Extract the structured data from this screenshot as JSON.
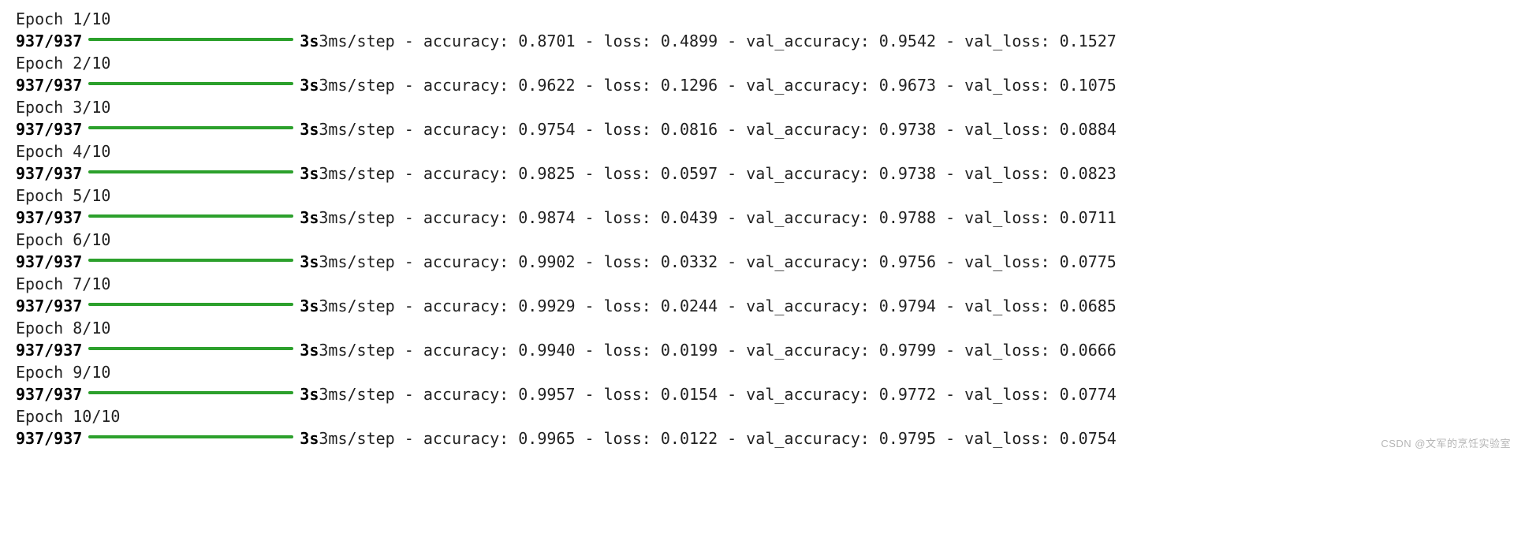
{
  "total_epochs": 10,
  "steps_current": "937",
  "steps_total": "937",
  "watermark": "CSDN @文军的烹饪实验室",
  "epochs": [
    {
      "header": "Epoch 1/10",
      "step_label": "937/937",
      "total_time": "3s",
      "time_per_step": "3ms/step",
      "accuracy": "0.8701",
      "loss": "0.4899",
      "val_accuracy": "0.9542",
      "val_loss": "0.1527"
    },
    {
      "header": "Epoch 2/10",
      "step_label": "937/937",
      "total_time": "3s",
      "time_per_step": "3ms/step",
      "accuracy": "0.9622",
      "loss": "0.1296",
      "val_accuracy": "0.9673",
      "val_loss": "0.1075"
    },
    {
      "header": "Epoch 3/10",
      "step_label": "937/937",
      "total_time": "3s",
      "time_per_step": "3ms/step",
      "accuracy": "0.9754",
      "loss": "0.0816",
      "val_accuracy": "0.9738",
      "val_loss": "0.0884"
    },
    {
      "header": "Epoch 4/10",
      "step_label": "937/937",
      "total_time": "3s",
      "time_per_step": "3ms/step",
      "accuracy": "0.9825",
      "loss": "0.0597",
      "val_accuracy": "0.9738",
      "val_loss": "0.0823"
    },
    {
      "header": "Epoch 5/10",
      "step_label": "937/937",
      "total_time": "3s",
      "time_per_step": "3ms/step",
      "accuracy": "0.9874",
      "loss": "0.0439",
      "val_accuracy": "0.9788",
      "val_loss": "0.0711"
    },
    {
      "header": "Epoch 6/10",
      "step_label": "937/937",
      "total_time": "3s",
      "time_per_step": "3ms/step",
      "accuracy": "0.9902",
      "loss": "0.0332",
      "val_accuracy": "0.9756",
      "val_loss": "0.0775"
    },
    {
      "header": "Epoch 7/10",
      "step_label": "937/937",
      "total_time": "3s",
      "time_per_step": "3ms/step",
      "accuracy": "0.9929",
      "loss": "0.0244",
      "val_accuracy": "0.9794",
      "val_loss": "0.0685"
    },
    {
      "header": "Epoch 8/10",
      "step_label": "937/937",
      "total_time": "3s",
      "time_per_step": "3ms/step",
      "accuracy": "0.9940",
      "loss": "0.0199",
      "val_accuracy": "0.9799",
      "val_loss": "0.0666"
    },
    {
      "header": "Epoch 9/10",
      "step_label": "937/937",
      "total_time": "3s",
      "time_per_step": "3ms/step",
      "accuracy": "0.9957",
      "loss": "0.0154",
      "val_accuracy": "0.9772",
      "val_loss": "0.0774"
    },
    {
      "header": "Epoch 10/10",
      "step_label": "937/937",
      "total_time": "3s",
      "time_per_step": "3ms/step",
      "accuracy": "0.9965",
      "loss": "0.0122",
      "val_accuracy": "0.9795",
      "val_loss": "0.0754"
    }
  ]
}
